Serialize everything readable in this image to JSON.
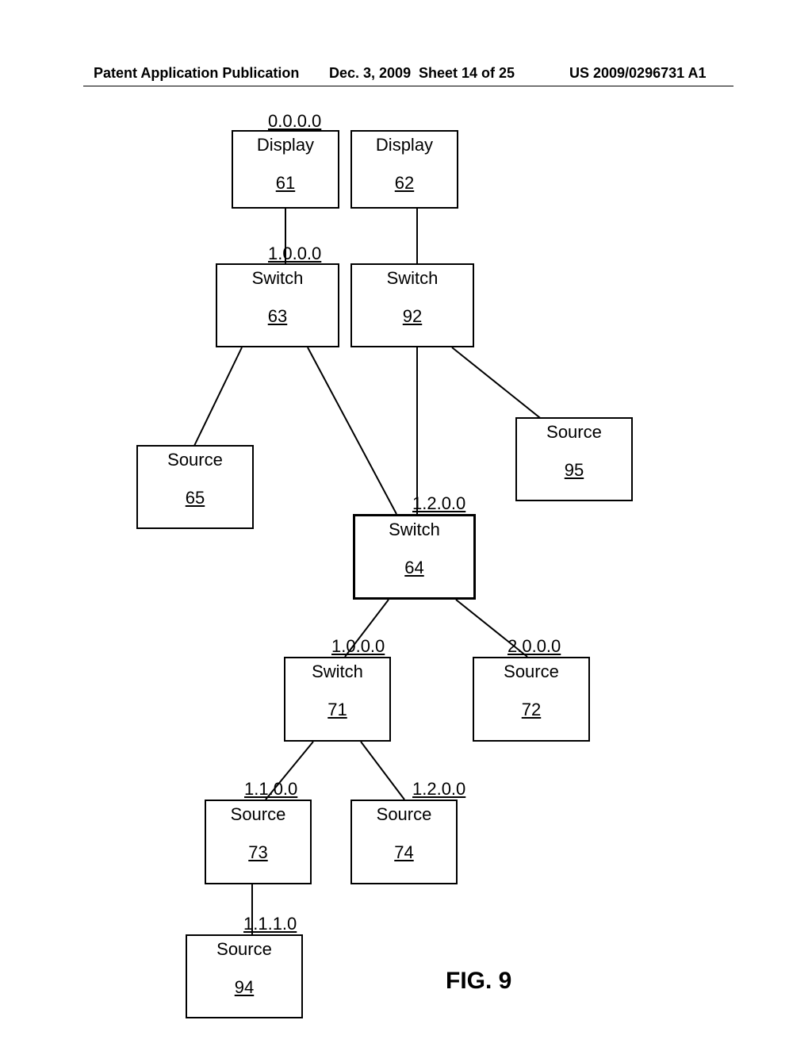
{
  "header": {
    "left": "Patent Application Publication",
    "date": "Dec. 3, 2009",
    "sheet": "Sheet 14 of 25",
    "pubno": "US 2009/0296731 A1"
  },
  "figure_label": "FIG. 9",
  "nodes": {
    "n61": {
      "type": "Display",
      "num": "61",
      "addr": "0.0.0.0"
    },
    "n62": {
      "type": "Display",
      "num": "62"
    },
    "n63": {
      "type": "Switch",
      "num": "63",
      "addr": "1.0.0.0"
    },
    "n92": {
      "type": "Switch",
      "num": "92"
    },
    "n65": {
      "type": "Source",
      "num": "65"
    },
    "n95": {
      "type": "Source",
      "num": "95"
    },
    "n64": {
      "type": "Switch",
      "num": "64",
      "addr": "1.2.0.0"
    },
    "n71": {
      "type": "Switch",
      "num": "71",
      "addr": "1.0.0.0"
    },
    "n72": {
      "type": "Source",
      "num": "72",
      "addr": "2.0.0.0"
    },
    "n73": {
      "type": "Source",
      "num": "73",
      "addr": "1.1.0.0"
    },
    "n74": {
      "type": "Source",
      "num": "74",
      "addr": "1.2.0.0"
    },
    "n94": {
      "type": "Source",
      "num": "94",
      "addr": "1.1.1.0"
    }
  }
}
